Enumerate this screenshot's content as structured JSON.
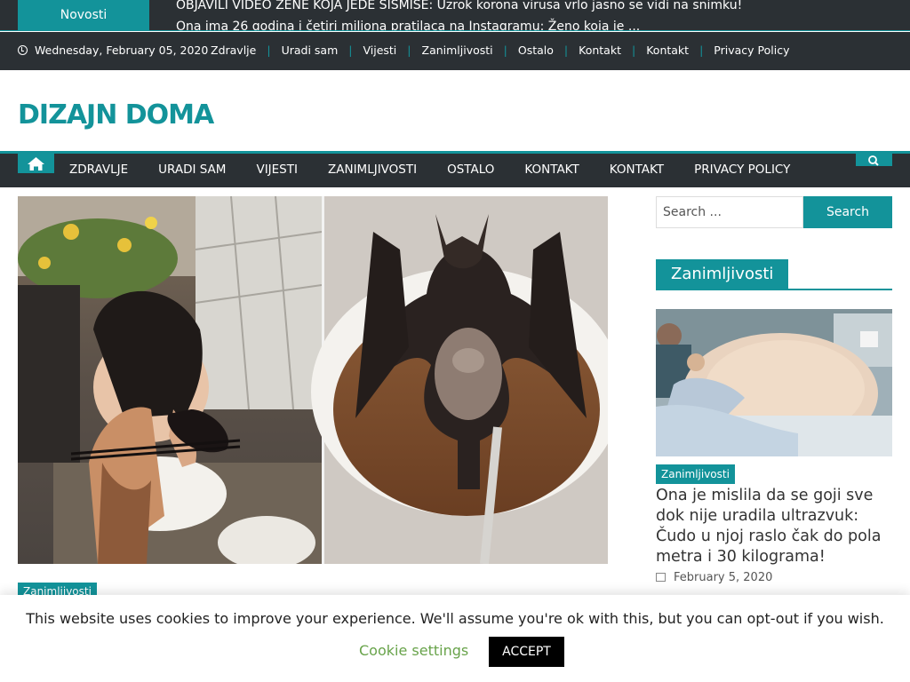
{
  "ticker": {
    "label": "Novosti",
    "headline_1": "OBJAVILI VIDEO ŽENE KOJA JEDE SISMISE: Uzrok korona virusa vrlo jasno se vidi na snimku!",
    "headline_2": "Ona ima 26 godina i četiri miliona pratilaca na Instagramu: Ženo koja je ..."
  },
  "topbar": {
    "date": "Wednesday, February 05, 2020",
    "links": [
      "Zdravlje",
      "Uradi sam",
      "Vijesti",
      "Zanimljivosti",
      "Ostalo",
      "Kontakt",
      "Kontakt",
      "Privacy Policy"
    ]
  },
  "site": {
    "title": "DIZAJN DOMA"
  },
  "mainnav": {
    "items": [
      "ZDRAVLJE",
      "URADI SAM",
      "VIJESTI",
      "ZANIMLJIVOSTI",
      "OSTALO",
      "KONTAKT",
      "KONTAKT",
      "PRIVACY POLICY"
    ]
  },
  "hero": {
    "category": "Zanimljivosti"
  },
  "sidebar": {
    "search_placeholder": "Search ...",
    "search_button": "Search",
    "widget_title": "Zanimljivosti",
    "post": {
      "category": "Zanimljivosti",
      "title": "Ona je mislila da se goji sve dok nije uradila ultrazvuk: Čudo u njoj raslo čak do pola metra i 30 kilograma!",
      "date": "February 5, 2020"
    }
  },
  "cookie": {
    "text": "This website uses cookies to improve your experience. We'll assume you're ok with this, but you can opt-out if you wish.",
    "settings_label": "Cookie settings",
    "accept_label": "ACCEPT"
  },
  "colors": {
    "accent": "#13939a",
    "dark": "#2b3034",
    "cookie_link": "#68a34a"
  }
}
